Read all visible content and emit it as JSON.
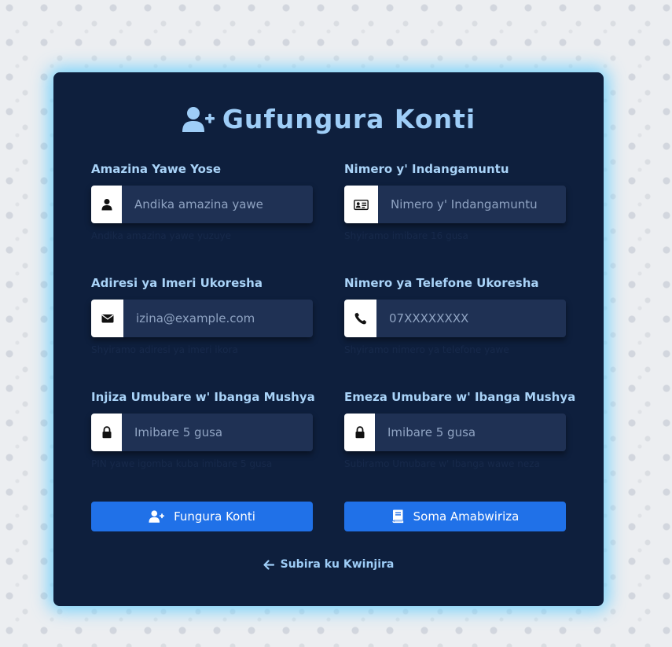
{
  "title": "Gufungura Konti",
  "fields": {
    "full_name": {
      "label": "Amazina Yawe Yose",
      "placeholder": "Andika amazina yawe",
      "help": "Andika amazina yawe yuzuye",
      "icon": "user-icon"
    },
    "national_id": {
      "label": "Nimero y' Indangamuntu",
      "placeholder": "Nimero y' Indangamuntu",
      "help": "Shyiramo imibare 16 gusa",
      "icon": "id-card-icon"
    },
    "email": {
      "label": "Adiresi ya Imeri Ukoresha",
      "placeholder": "izina@example.com",
      "help": "Shyiramo adiresi ya imeri ikora",
      "icon": "envelope-icon"
    },
    "phone": {
      "label": "Nimero ya Telefone Ukoresha",
      "placeholder": "07XXXXXXXX",
      "help": "Shyiramo nimero ya telefone yawe",
      "icon": "phone-icon"
    },
    "new_pin": {
      "label": "Injiza Umubare w' Ibanga Mushya",
      "placeholder": "Imibare 5 gusa",
      "help": "PIN yawe igomba kuba imibare 5 gusa",
      "icon": "lock-icon"
    },
    "confirm_pin": {
      "label": "Emeza Umubare w' Ibanga Mushya",
      "placeholder": "Imibare 5 gusa",
      "help": "Subiramo Umubare w' Ibanga wawe neza",
      "icon": "lock-icon"
    }
  },
  "buttons": {
    "register": "Fungura Konti",
    "terms": "Soma Amabwiriza"
  },
  "back_link": "Subira ku Kwinjira",
  "colors": {
    "card_bg": "#0e1f3d",
    "accent": "#9ecdf7",
    "button": "#2071e8",
    "input_bg": "#1f3154",
    "glow": "#50c8ff"
  }
}
